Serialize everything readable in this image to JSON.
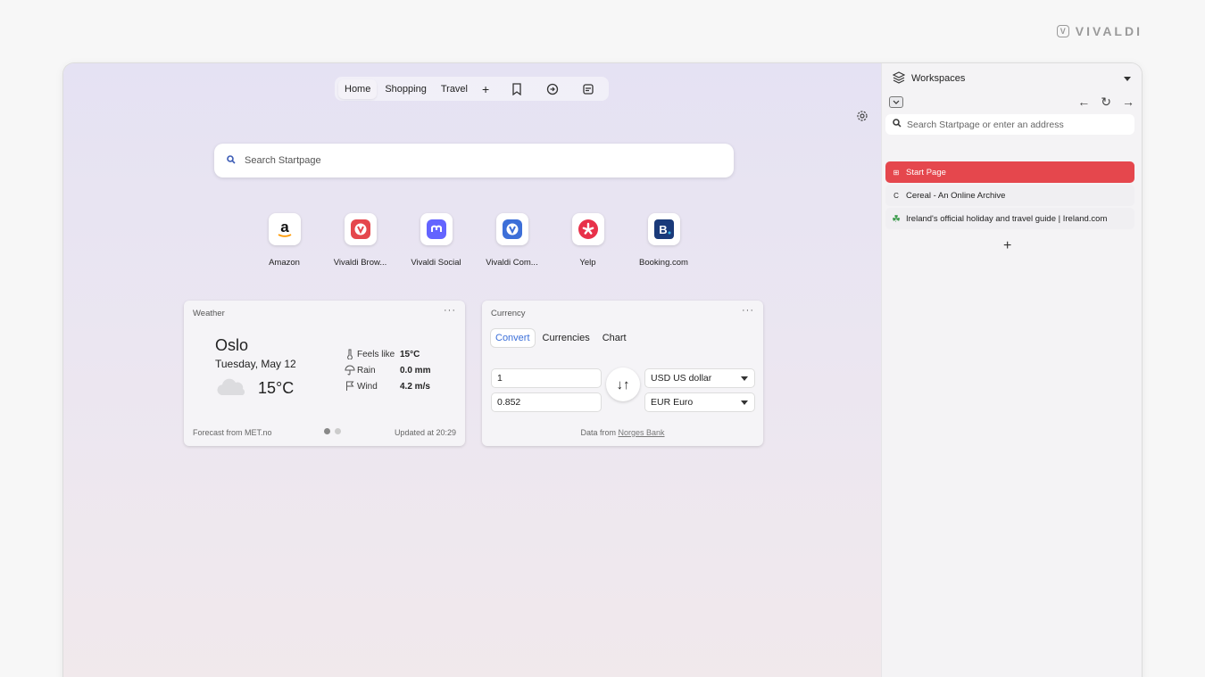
{
  "brand": {
    "name": "VIVALDI",
    "logo_glyph": "V"
  },
  "nav": {
    "tabs": [
      {
        "label": "Home"
      },
      {
        "label": "Shopping"
      },
      {
        "label": "Travel"
      }
    ],
    "add_label": "+"
  },
  "search": {
    "placeholder": "Search Startpage"
  },
  "speed_dials": [
    {
      "label": "Amazon",
      "icon": "amazon-icon"
    },
    {
      "label": "Vivaldi Brow...",
      "icon": "vivaldi-icon"
    },
    {
      "label": "Vivaldi Social",
      "icon": "mastodon-icon"
    },
    {
      "label": "Vivaldi Com...",
      "icon": "vivaldi-community-icon"
    },
    {
      "label": "Yelp",
      "icon": "yelp-icon"
    },
    {
      "label": "Booking.com",
      "icon": "booking-icon"
    }
  ],
  "weather": {
    "title": "Weather",
    "menu": "···",
    "city": "Oslo",
    "date": "Tuesday, May 12",
    "temperature": "15°C",
    "rows": [
      {
        "label": "Feels like",
        "value": "15°C"
      },
      {
        "label": "Rain",
        "value": "0.0 mm"
      },
      {
        "label": "Wind",
        "value": "4.2 m/s"
      }
    ],
    "source": "Forecast from MET.no",
    "updated": "Updated at 20:29"
  },
  "currency": {
    "title": "Currency",
    "menu": "···",
    "tabs": [
      {
        "label": "Convert"
      },
      {
        "label": "Currencies"
      },
      {
        "label": "Chart"
      }
    ],
    "amount_from": "1",
    "amount_to": "0.852",
    "swap": "↓↑",
    "from_currency": "USD US dollar",
    "to_currency": "EUR Euro",
    "footer_prefix": "Data from",
    "footer_link": "Norges Bank"
  },
  "panel": {
    "workspaces_label": "Workspaces",
    "back": "←",
    "reload": "↻",
    "forward": "→",
    "address_placeholder": "Search Startpage or enter an address",
    "tabs": [
      {
        "label": "Start Page",
        "favicon": "⊞"
      },
      {
        "label": "Cereal - An Online Archive",
        "favicon": "C"
      },
      {
        "label": "Ireland's official holiday and travel guide | Ireland.com",
        "favicon": "☘"
      }
    ],
    "new_tab": "+"
  },
  "colors": {
    "accent": "#e5474d",
    "link": "#3b6fd9"
  }
}
